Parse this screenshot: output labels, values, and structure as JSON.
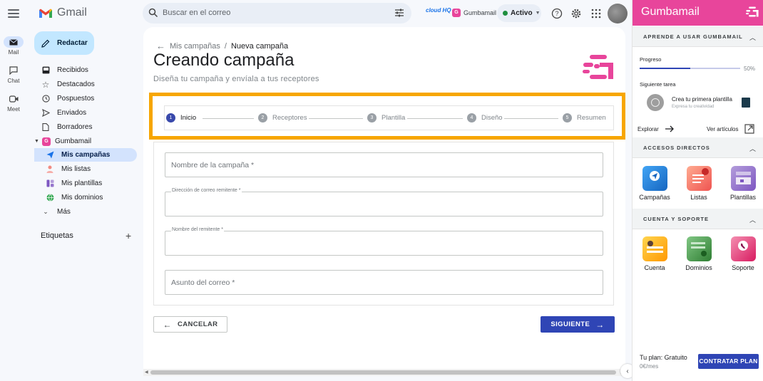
{
  "app": {
    "name": "Gmail"
  },
  "search": {
    "placeholder": "Buscar en el correo"
  },
  "topbar": {
    "cloudhq_label": "cloud HQ",
    "gumbamail_label": "Gumbamail",
    "status_label": "Activo"
  },
  "rail": {
    "mail": "Mail",
    "chat": "Chat",
    "meet": "Meet"
  },
  "compose_label": "Redactar",
  "nav": {
    "inbox": "Recibidos",
    "starred": "Destacados",
    "snoozed": "Pospuestos",
    "sent": "Enviados",
    "drafts": "Borradores",
    "gumbamail": "Gumbamail",
    "campaigns": "Mis campañas",
    "lists": "Mis listas",
    "templates": "Mis plantillas",
    "domains": "Mis dominios",
    "more": "Más"
  },
  "labels_title": "Etiquetas",
  "main": {
    "breadcrumb_parent": "Mis campañas",
    "breadcrumb_sep": "/",
    "breadcrumb_current": "Nueva campaña",
    "title": "Creando campaña",
    "subtitle": "Diseña tu campaña y envíala a tus receptores"
  },
  "steps": [
    {
      "num": "1",
      "label": "Inicio"
    },
    {
      "num": "2",
      "label": "Receptores"
    },
    {
      "num": "3",
      "label": "Plantilla"
    },
    {
      "num": "4",
      "label": "Diseño"
    },
    {
      "num": "5",
      "label": "Resumen"
    }
  ],
  "form": {
    "campaign_name_placeholder": "Nombre de la campaña *",
    "sender_email_label": "Dirección de correo remitente *",
    "sender_name_label": "Nombre del remitente *",
    "subject_placeholder": "Asunto del correo *"
  },
  "buttons": {
    "cancel": "CANCELAR",
    "next": "SIGUIENTE"
  },
  "panel": {
    "title": "Gumbamail",
    "learn_section": "APRENDE A USAR GUMBAMAIL",
    "progress_label": "Progreso",
    "progress_value": 0.5,
    "progress_text": "50%",
    "next_task_label": "Siguiente tarea",
    "task_title": "Crea tu primera plantilla",
    "task_subtitle": "Expresa tu creatividad",
    "explore_label": "Explorar",
    "articles_label": "Ver artículos",
    "shortcuts_section": "ACCESOS DIRECTOS",
    "shortcuts": [
      "Campañas",
      "Listas",
      "Plantillas"
    ],
    "support_section": "CUENTA Y SOPORTE",
    "support_items": [
      "Cuenta",
      "Dominios",
      "Soporte"
    ],
    "plan_label": "Tu plan: Gratuito",
    "plan_price": "0€/mes",
    "plan_button": "CONTRATAR PLAN"
  },
  "colors": {
    "accent": "#2f45b5",
    "brand_pink": "#e8459b",
    "highlight_outline": "#f7a600",
    "active_nav": "#d3e3fd"
  }
}
